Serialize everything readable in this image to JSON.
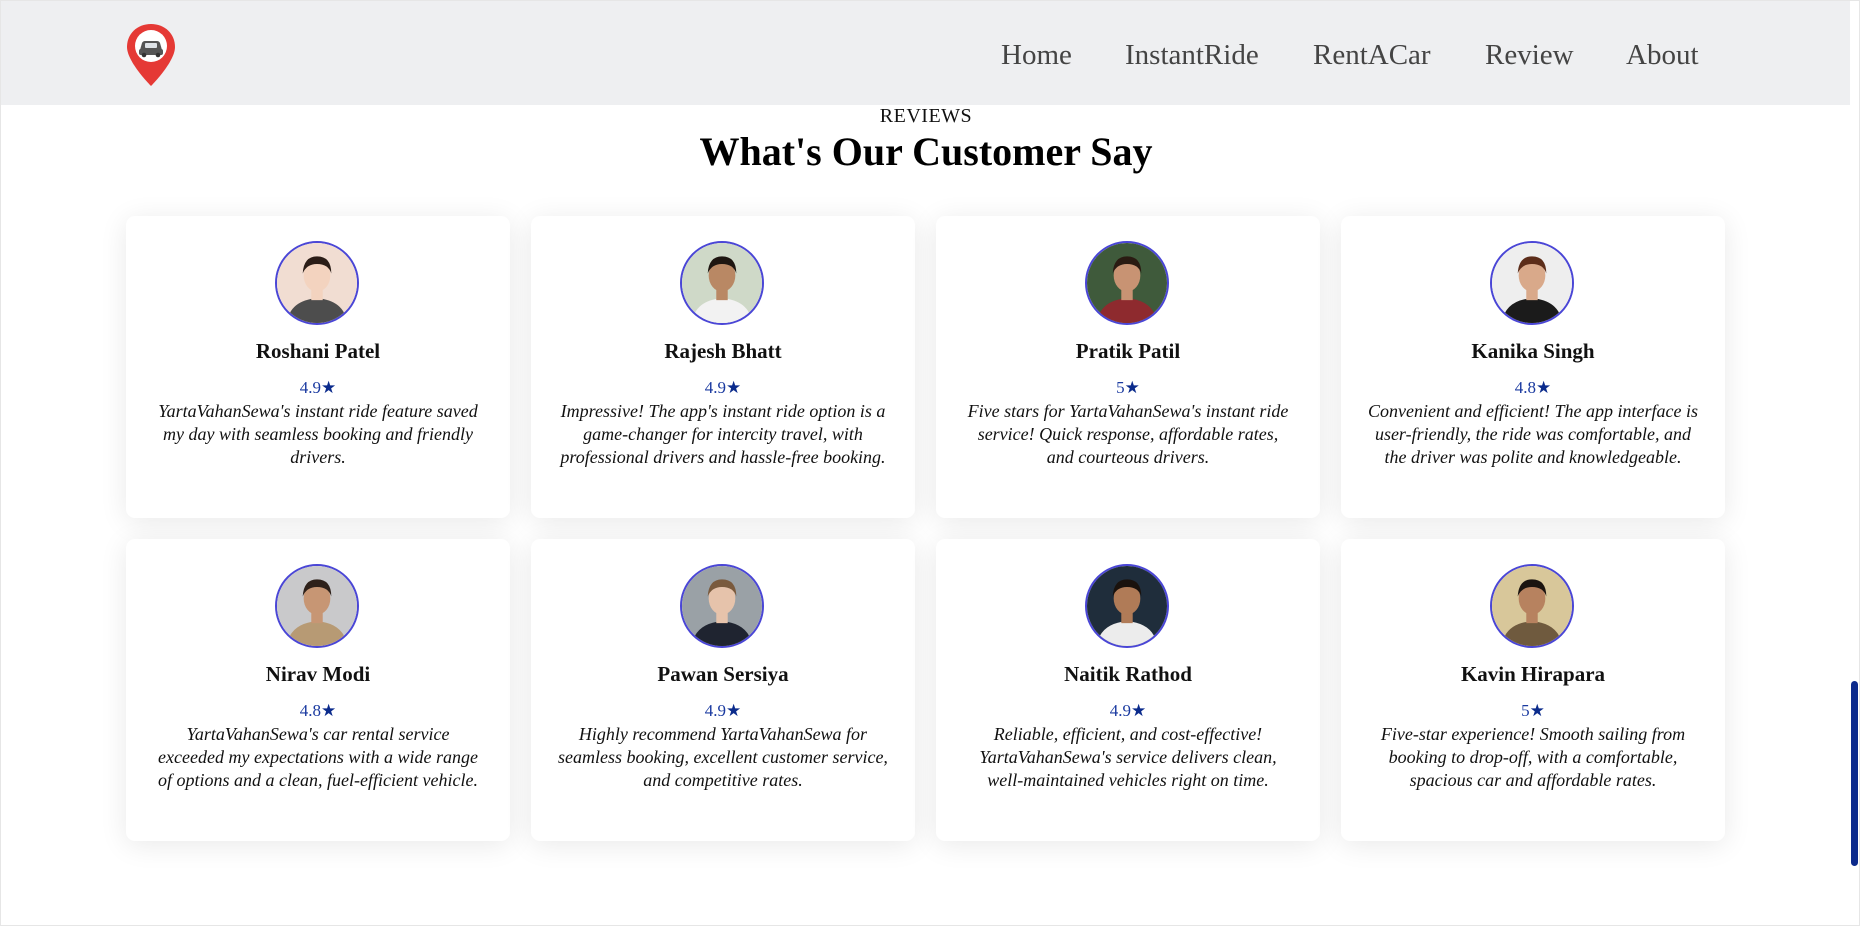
{
  "nav": {
    "logo_icon": "car-location-pin-icon",
    "links": [
      "Home",
      "InstantRide",
      "RentACar",
      "Review",
      "About"
    ]
  },
  "section": {
    "eyebrow": "REVIEWS",
    "title": "What's Our Customer Say"
  },
  "colors": {
    "accent": "#0b2b8c",
    "avatar_border": "#4a46d6",
    "header_bg": "#eeeff1",
    "logo_red": "#e53935"
  },
  "reviews": [
    {
      "name": "Roshani Patel",
      "rating": "4.9",
      "text": "YartaVahanSewa's instant ride feature saved my day with seamless booking and friendly drivers."
    },
    {
      "name": "Rajesh Bhatt",
      "rating": "4.9",
      "text": "Impressive! The app's instant ride option is a game-changer for intercity travel, with professional drivers and hassle-free booking."
    },
    {
      "name": "Pratik Patil",
      "rating": "5",
      "text": "Five stars for YartaVahanSewa's instant ride service! Quick response, affordable rates, and courteous drivers."
    },
    {
      "name": "Kanika Singh",
      "rating": "4.8",
      "text": "Convenient and efficient! The app interface is user-friendly, the ride was comfortable, and the driver was polite and knowledgeable."
    },
    {
      "name": "Nirav Modi",
      "rating": "4.8",
      "text": "YartaVahanSewa's car rental service exceeded my expectations with a wide range of options and a clean, fuel-efficient vehicle."
    },
    {
      "name": "Pawan Sersiya",
      "rating": "4.9",
      "text": "Highly recommend YartaVahanSewa for seamless booking, excellent customer service, and competitive rates."
    },
    {
      "name": "Naitik Rathod",
      "rating": "4.9",
      "text": "Reliable, efficient, and cost-effective! YartaVahanSewa's service delivers clean, well-maintained vehicles right on time."
    },
    {
      "name": "Kavin Hirapara",
      "rating": "5",
      "text": "Five-star experience! Smooth sailing from booking to drop-off, with a comfortable, spacious car and affordable rates."
    }
  ]
}
